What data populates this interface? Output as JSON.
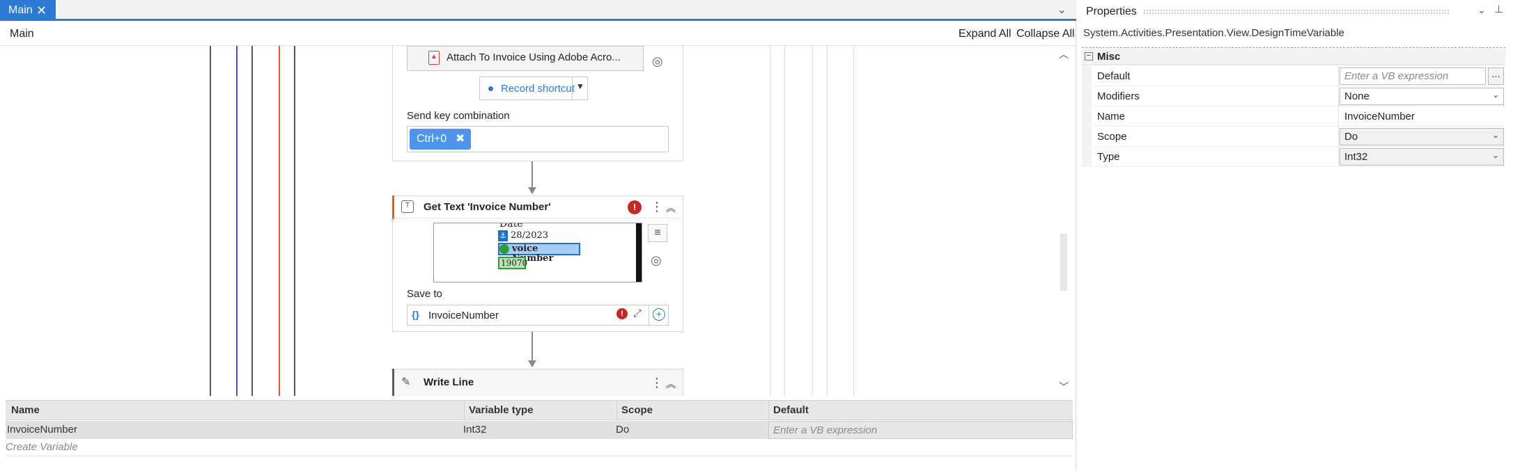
{
  "tab": {
    "label": "Main"
  },
  "breadcrumb": "Main",
  "designer_actions": {
    "expand_all": "Expand All",
    "collapse_all": "Collapse All"
  },
  "activities": {
    "attach": {
      "label": "Attach To Invoice Using Adobe Acro...",
      "record_shortcut": "Record shortcut",
      "send_key_label": "Send key combination",
      "key_chip": "Ctrl+0"
    },
    "get_text": {
      "title": "Get Text 'Invoice Number'",
      "preview": {
        "date_text": "Date",
        "date_value": "28/2023",
        "label_text": "voice Number",
        "value_text": "19070"
      },
      "save_to_label": "Save to",
      "save_to_value": "InvoiceNumber",
      "error_mark": "!"
    },
    "write_line": {
      "title": "Write Line"
    }
  },
  "colors": {
    "accent": "#2b7bd6",
    "error": "#c62828",
    "guide_lines": [
      "#555555",
      "#4a4ad6",
      "#555555",
      "#e8552a",
      "#555555"
    ]
  },
  "variables": {
    "columns": [
      "Name",
      "Variable type",
      "Scope",
      "Default"
    ],
    "rows": [
      {
        "name": "InvoiceNumber",
        "type": "Int32",
        "scope": "Do",
        "default_placeholder": "Enter a VB expression"
      }
    ],
    "create_label": "Create Variable"
  },
  "properties": {
    "title": "Properties",
    "object_type": "System.Activities.Presentation.View.DesignTimeVariable",
    "category": "Misc",
    "rows": {
      "default": {
        "label": "Default",
        "placeholder": "Enter a VB expression",
        "button": "..."
      },
      "modifiers": {
        "label": "Modifiers",
        "value": "None"
      },
      "name": {
        "label": "Name",
        "value": "InvoiceNumber"
      },
      "scope": {
        "label": "Scope",
        "value": "Do"
      },
      "type": {
        "label": "Type",
        "value": "Int32"
      }
    }
  }
}
